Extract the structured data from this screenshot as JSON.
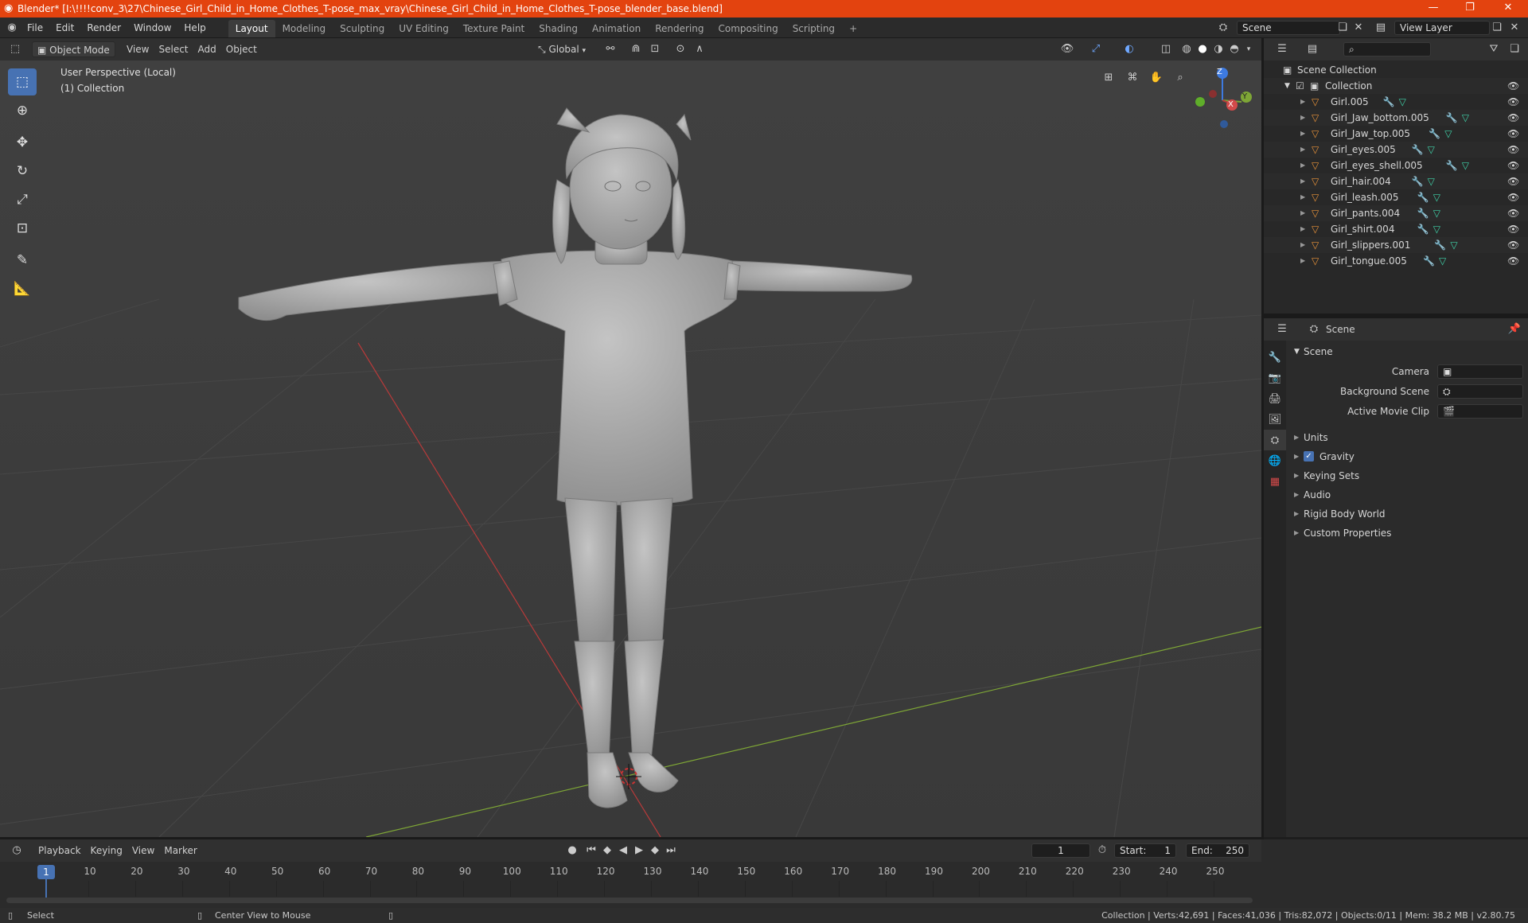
{
  "window": {
    "title": "Blender* [I:\\!!!!conv_3\\27\\Chinese_Girl_Child_in_Home_Clothes_T-pose_max_vray\\Chinese_Girl_Child_in_Home_Clothes_T-pose_blender_base.blend]",
    "minimize": "—",
    "maximize": "❐",
    "close": "✕"
  },
  "menu": [
    "File",
    "Edit",
    "Render",
    "Window",
    "Help"
  ],
  "workspaces": [
    "Layout",
    "Modeling",
    "Sculpting",
    "UV Editing",
    "Texture Paint",
    "Shading",
    "Animation",
    "Rendering",
    "Compositing",
    "Scripting"
  ],
  "workspace_add": "+",
  "scene_field": "Scene",
  "view_layer_field": "View Layer",
  "viewport": {
    "mode": "Object Mode",
    "menus": [
      "View",
      "Select",
      "Add",
      "Object"
    ],
    "transform_orientation": "Global",
    "overlay_line1": "User Perspective (Local)",
    "overlay_line2": "(1) Collection",
    "gizmo": {
      "z": "Z",
      "y": "Y",
      "x": "X"
    }
  },
  "outliner": {
    "search_placeholder": "",
    "root": "Scene Collection",
    "collection": "Collection",
    "objects": [
      "Girl.005",
      "Girl_Jaw_bottom.005",
      "Girl_Jaw_top.005",
      "Girl_eyes.005",
      "Girl_eyes_shell.005",
      "Girl_hair.004",
      "Girl_leash.005",
      "Girl_pants.004",
      "Girl_shirt.004",
      "Girl_slippers.001",
      "Girl_tongue.005"
    ]
  },
  "properties": {
    "header": "Scene",
    "panel_title": "Scene",
    "camera_label": "Camera",
    "background_scene_label": "Background Scene",
    "active_movie_clip_label": "Active Movie Clip",
    "sections": [
      "Units",
      "Gravity",
      "Keying Sets",
      "Audio",
      "Rigid Body World",
      "Custom Properties"
    ]
  },
  "timeline": {
    "menus": [
      "Playback",
      "Keying",
      "View",
      "Marker"
    ],
    "current_frame": "1",
    "start_label": "Start:",
    "start_value": "1",
    "end_label": "End:",
    "end_value": "250",
    "ticks": [
      "10",
      "20",
      "30",
      "40",
      "50",
      "60",
      "70",
      "80",
      "90",
      "100",
      "110",
      "120",
      "130",
      "140",
      "150",
      "160",
      "170",
      "180",
      "190",
      "200",
      "210",
      "220",
      "230",
      "240",
      "250"
    ],
    "cursor_frame": "1"
  },
  "status": {
    "left_action": "Select",
    "middle_action": "Center View to Mouse",
    "stats": "Collection | Verts:42,691 | Faces:41,036 | Tris:82,072 | Objects:0/11 | Mem: 38.2 MB | v2.80.75"
  },
  "colors": {
    "titlebar": "#e3430f",
    "active_tool": "#4772b3",
    "mesh_icon": "#e8923a",
    "modifier_icon": "#6fa8ff",
    "data_icon": "#3fd2a8",
    "x_axis": "#b83a3a",
    "y_axis": "#7ea636"
  }
}
